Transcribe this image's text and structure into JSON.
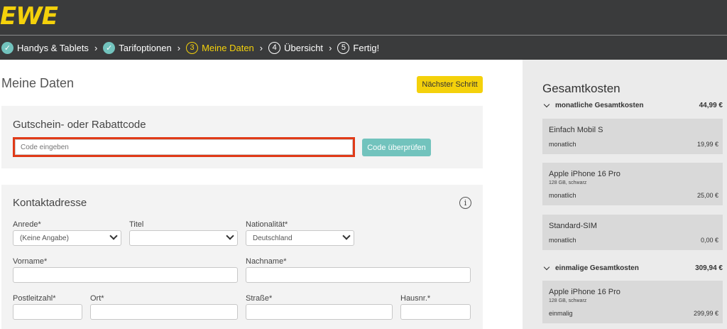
{
  "header": {
    "logo": "EWE"
  },
  "steps": [
    {
      "label": "Handys & Tablets",
      "state": "done"
    },
    {
      "label": "Tarifoptionen",
      "state": "done"
    },
    {
      "num": "3",
      "label": "Meine Daten",
      "state": "active"
    },
    {
      "num": "4",
      "label": "Übersicht",
      "state": "todo"
    },
    {
      "num": "5",
      "label": "Fertig!",
      "state": "todo"
    }
  ],
  "main": {
    "title": "Meine Daten",
    "next_button": "Nächster Schritt",
    "voucher": {
      "heading": "Gutschein- oder Rabattcode",
      "placeholder": "Code eingeben",
      "verify_button": "Code überprüfen"
    },
    "contact": {
      "heading": "Kontaktadresse",
      "info_icon": "i",
      "anrede_label": "Anrede*",
      "anrede_value": "(Keine Angabe)",
      "titel_label": "Titel",
      "titel_value": "",
      "nationalitaet_label": "Nationalität*",
      "nationalitaet_value": "Deutschland",
      "vorname_label": "Vorname*",
      "nachname_label": "Nachname*",
      "plz_label": "Postleitzahl*",
      "ort_label": "Ort*",
      "strasse_label": "Straße*",
      "hausnr_label": "Hausnr.*"
    }
  },
  "sidebar": {
    "title": "Gesamtkosten",
    "monthly": {
      "label": "monatliche Gesamtkosten",
      "total": "44,99 €",
      "items": [
        {
          "name": "Einfach Mobil S",
          "sub": "",
          "period": "monatlich",
          "price": "19,99 €"
        },
        {
          "name": "Apple iPhone 16 Pro",
          "sub": "128 GB, schwarz",
          "period": "monatlich",
          "price": "25,00 €"
        },
        {
          "name": "Standard-SIM",
          "sub": "",
          "period": "monatlich",
          "price": "0,00 €"
        }
      ]
    },
    "once": {
      "label": "einmalige Gesamtkosten",
      "total": "309,94 €",
      "items": [
        {
          "name": "Apple iPhone 16 Pro",
          "sub": "128 GB, schwarz",
          "period": "einmalig",
          "price": "299,99 €"
        }
      ]
    }
  },
  "colors": {
    "brand_yellow": "#f4d10b",
    "teal": "#72c3bd",
    "highlight_red": "#e03a18",
    "dark": "#3a3b3c"
  }
}
